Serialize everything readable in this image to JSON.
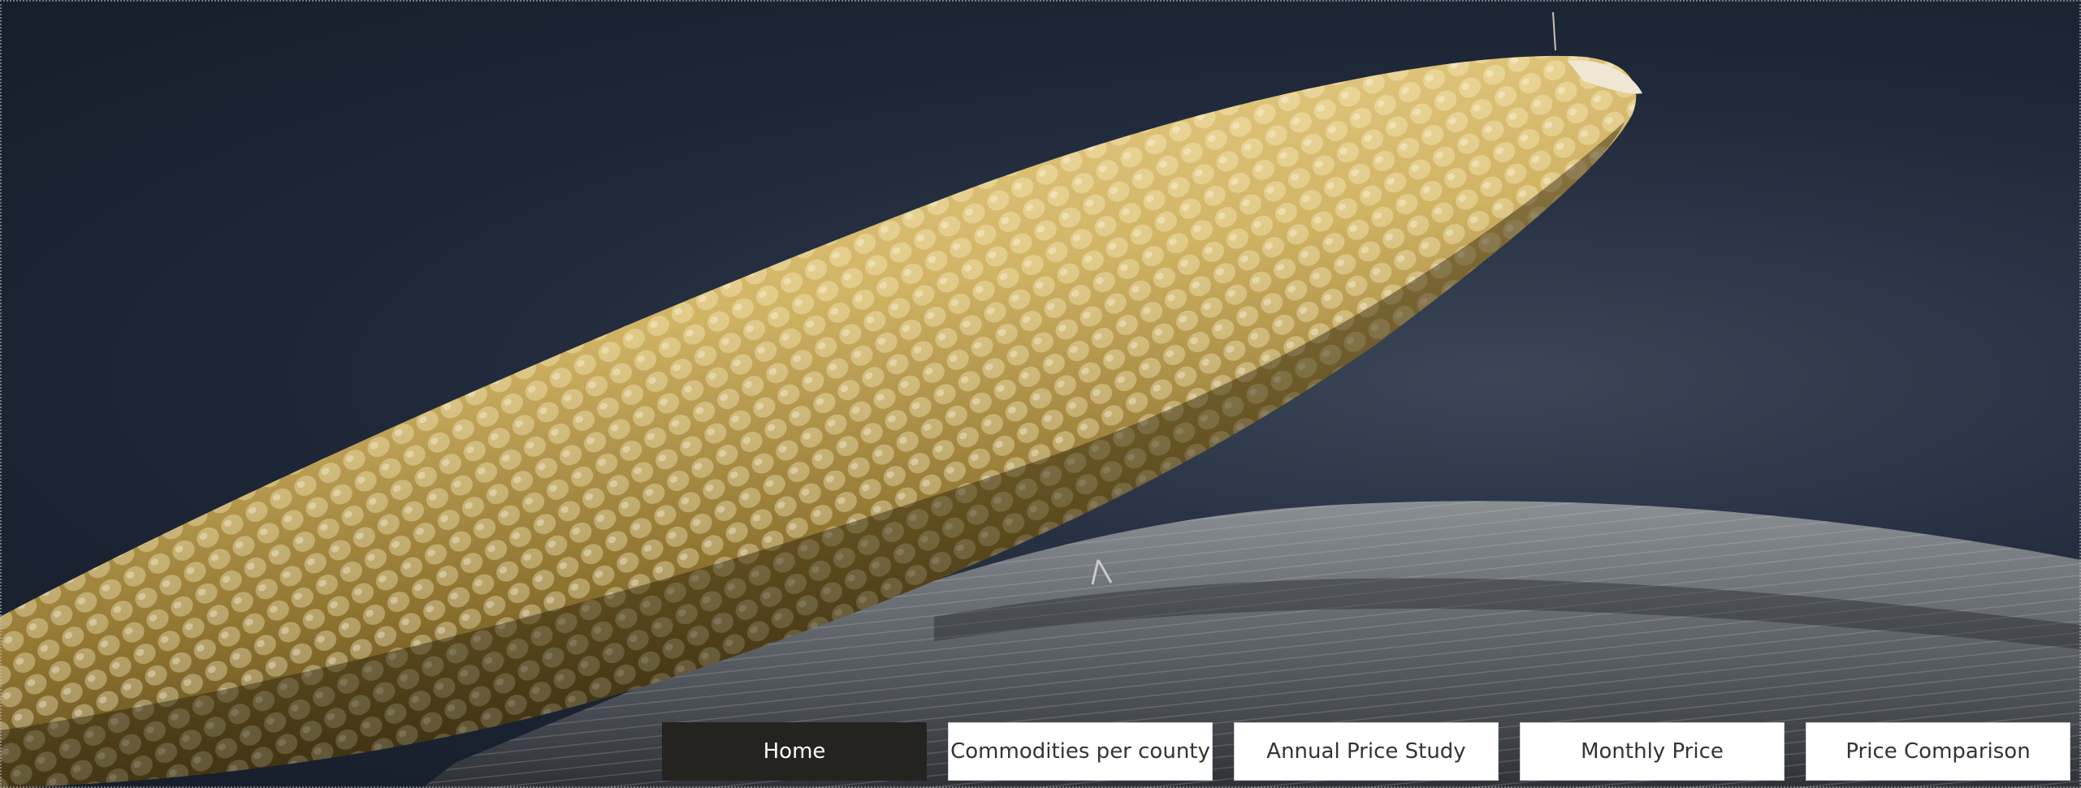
{
  "hero": {
    "image": "corn-cob-photo",
    "colors": {
      "background": "#1e2737",
      "kernel_light": "#e8cf8a",
      "kernel_dark": "#7a6326",
      "husk": "#6f747a"
    }
  },
  "nav": {
    "items": [
      {
        "label": "Home",
        "active": true
      },
      {
        "label": "Commodities per county",
        "active": false
      },
      {
        "label": "Annual Price Study",
        "active": false
      },
      {
        "label": "Monthly Price",
        "active": false
      },
      {
        "label": "Price Comparison",
        "active": false
      }
    ],
    "colors": {
      "active_bg": "#252320",
      "active_fg": "#ffffff",
      "inactive_bg": "#ffffff",
      "inactive_fg": "#333333"
    }
  }
}
